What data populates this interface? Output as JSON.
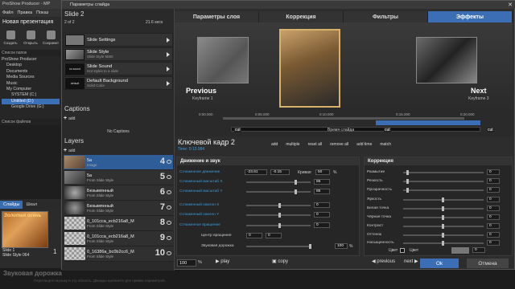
{
  "app": {
    "title": "ProShow Producer - MP",
    "menu": [
      "Файл",
      "Правка",
      "Показ"
    ],
    "project": "Новая презентация",
    "toolbar": [
      "Создать",
      "Открыть",
      "Сохранит"
    ],
    "folders_header": "Список папок",
    "tree": [
      "ProShow Producer",
      "Desktop",
      "Documents",
      "Media Sources",
      "Music",
      "My Computer",
      "SYSTEM (C:)",
      "Untitled (D:)",
      "Google Drive (G:)"
    ],
    "files_header": "Список файлов",
    "slides_tabs": [
      "Слайды",
      "Шкал"
    ],
    "slide_thumb_text": "Золотая осень",
    "slide_label": "Slide 1",
    "slide_style": "Slide Style 064",
    "slide_num": "1",
    "soundtrack": "Звуковая дорожка",
    "soundtrack_hint": "Перетащите музыку в эту область. Дважды щелкните для правки параметров."
  },
  "dialog": {
    "title": "Параметры слайда",
    "close": "✕",
    "slide_title": "Slide 2",
    "slide_count": "2 of 2",
    "slide_time": "21.6 secs",
    "options": [
      {
        "label": "Slide Settings",
        "sub": ""
      },
      {
        "label": "Slide Style",
        "sub": "Slide Style 5550"
      },
      {
        "label": "Slide Sound",
        "sub": "Hot styles to a slide",
        "thumb": "no sound"
      },
      {
        "label": "Default Background",
        "sub": "Solid Color",
        "thumb": "default"
      }
    ],
    "captions_h": "Captions",
    "add": "add",
    "no_captions": "No Captions",
    "layers_h": "Layers",
    "layers": [
      {
        "name": "5а",
        "style": "Image",
        "num": "4"
      },
      {
        "name": "5а",
        "style": "From Slide Style",
        "num": "5"
      },
      {
        "name": "Безымянный",
        "style": "From Slide Style",
        "num": "6"
      },
      {
        "name": "Безымянный",
        "style": "From Slide Style",
        "num": "7"
      },
      {
        "name": "0_101cca_ecb216a8_M",
        "style": "From Slide Style",
        "num": "8"
      },
      {
        "name": "0_101cca_ecb216a8_M",
        "style": "From Slide Style",
        "num": "9"
      },
      {
        "name": "0_16386a_bc0b2cc6_M",
        "style": "From Slide Style",
        "num": "10"
      }
    ]
  },
  "tabs": [
    "Параметры слоя",
    "Коррекция",
    "Фильтры",
    "Эффекты"
  ],
  "preview": {
    "prev_label": "Previous",
    "prev_sub": "Keyframe 1",
    "next_label": "Next",
    "next_sub": "Keyframe 3"
  },
  "timeline": {
    "ticks": [
      "0:00.000",
      "0:05.000",
      "0:10.000",
      "0:15.000",
      "0:20.000"
    ],
    "slide_time_label": "Время слайда",
    "markers": [
      "cut",
      "cut",
      "cut"
    ]
  },
  "keyframe": {
    "title": "Ключевой кадр 2",
    "time": "Time: 0:13.984",
    "tools": [
      "add",
      "multiple",
      "reset all",
      "remove all",
      "add time",
      "match"
    ]
  },
  "motion": {
    "header": "Движение и звук",
    "rows": [
      {
        "label": "Сглаженное движение",
        "v1": "-23.61",
        "v2": "-0.15",
        "extra_label": "Кривая",
        "v3": "50",
        "unit": "%"
      },
      {
        "label": "Сглаженный масштаб X",
        "v1": "",
        "v3": "86",
        "unit": "%"
      },
      {
        "label": "Сглаженный масштаб Y",
        "v1": "",
        "v3": "86",
        "unit": "%"
      },
      {
        "label": "Сглаженный наклон X",
        "v3": "0"
      },
      {
        "label": "Сглаженный наклон Y",
        "v3": "0"
      },
      {
        "label": "Сглаженное вращение",
        "v3": "0"
      },
      {
        "label": "Центр вращения",
        "v1": "0",
        "v2": "0"
      },
      {
        "label": "Звуковая дорожка",
        "v3": "100",
        "unit": "%"
      }
    ]
  },
  "correction": {
    "header": "Коррекция",
    "rows": [
      {
        "label": "Размытие",
        "v": "0"
      },
      {
        "label": "Резкость",
        "v": "0"
      },
      {
        "label": "Прозрачность",
        "v": "0"
      },
      {
        "label": "Яркость",
        "v": "0"
      },
      {
        "label": "Белая точка",
        "v": "0"
      },
      {
        "label": "Чёрная точка",
        "v": "0"
      },
      {
        "label": "Контраст",
        "v": "0"
      },
      {
        "label": "Оттенок",
        "v": "0"
      },
      {
        "label": "Насыщенность",
        "v": "0"
      }
    ],
    "color_label": "Цвет",
    "color_label2": "Цвет",
    "color_pct": "0"
  },
  "bottom": {
    "zoom": "100",
    "zoom_unit": "%",
    "play": "play",
    "copy": "copy",
    "previous": "previous",
    "next": "next",
    "ok": "Ok",
    "cancel": "Отмена"
  }
}
